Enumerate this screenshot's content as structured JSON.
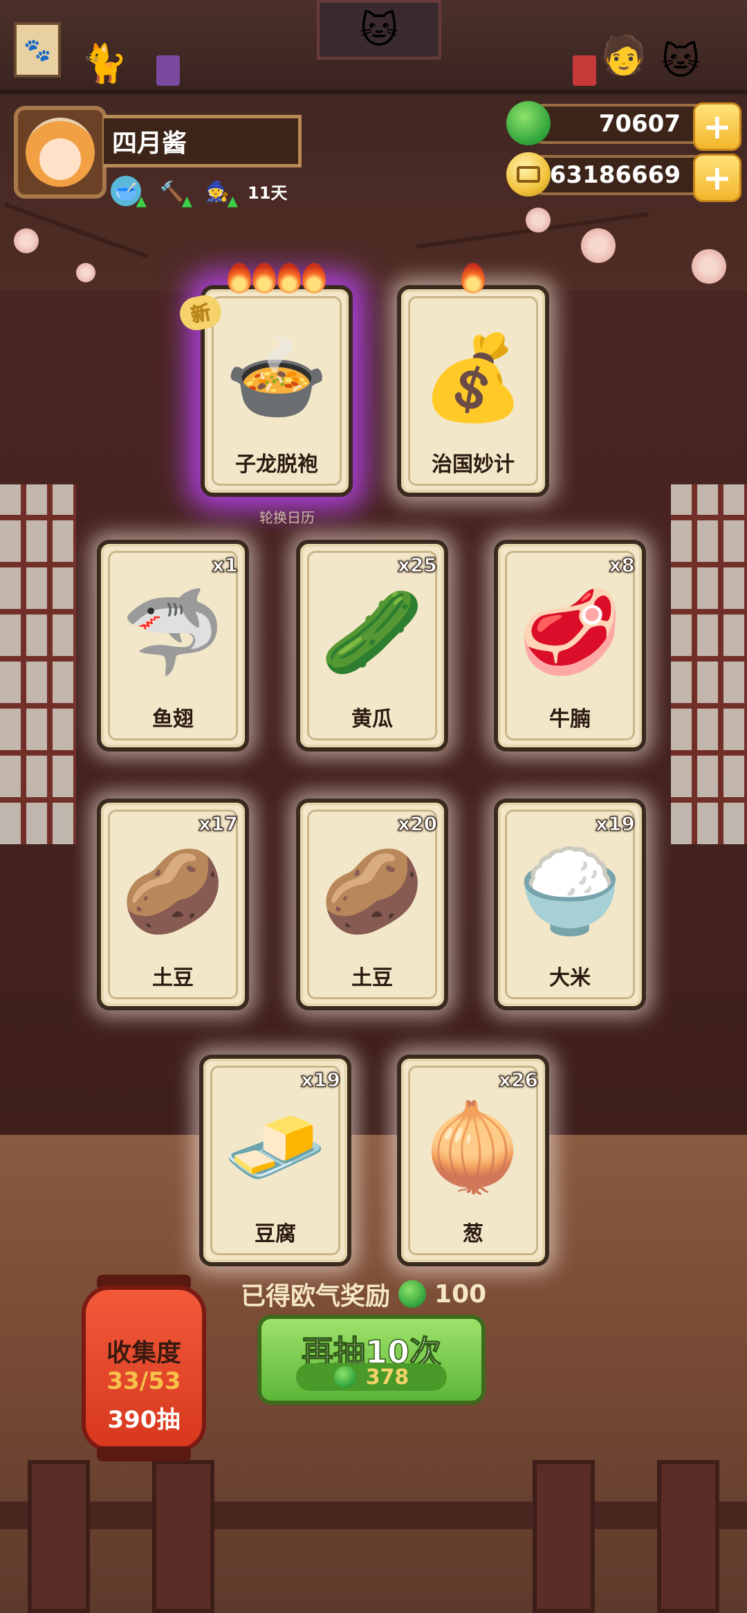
{
  "player": {
    "name": "四月酱",
    "days": "11天"
  },
  "currency": {
    "apples": "70607",
    "coins": "63186669"
  },
  "featured": [
    {
      "label": "子龙脱袍",
      "icon": "🍲",
      "flames": 4,
      "new": "新"
    },
    {
      "label": "治国妙计",
      "icon": "💰",
      "flames": 1
    }
  ],
  "calendar_text": "轮换日历",
  "cards": [
    {
      "label": "鱼翅",
      "qty": "x1",
      "icon": "🦈"
    },
    {
      "label": "黄瓜",
      "qty": "x25",
      "icon": "🥒"
    },
    {
      "label": "牛腩",
      "qty": "x8",
      "icon": "🥩"
    },
    {
      "label": "土豆",
      "qty": "x17",
      "icon": "🥔"
    },
    {
      "label": "土豆",
      "qty": "x20",
      "icon": "🥔"
    },
    {
      "label": "大米",
      "qty": "x19",
      "icon": "🍚"
    },
    {
      "label": "豆腐",
      "qty": "x19",
      "icon": "🧈"
    },
    {
      "label": "葱",
      "qty": "x26",
      "icon": "🧅"
    }
  ],
  "reward": {
    "text": "已得欧气奖励",
    "amount": "100"
  },
  "draw_button": {
    "label": "再抽10次",
    "cost": "378"
  },
  "collection": {
    "label": "收集度",
    "progress": "33/53",
    "draws": "390抽"
  }
}
